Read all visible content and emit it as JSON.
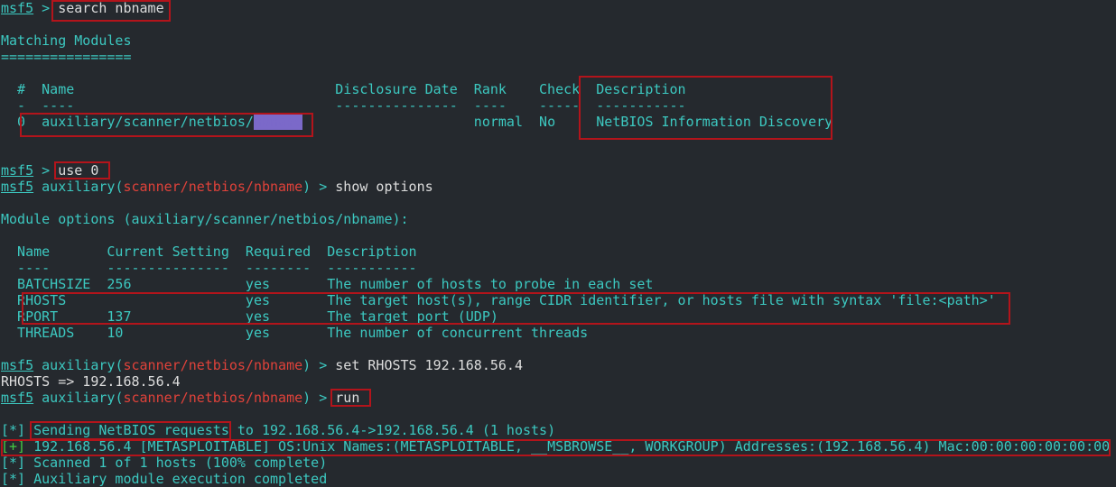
{
  "prompt": {
    "name": "msf5",
    "sep": " > "
  },
  "cmd1": "search nbname",
  "matching_title": "Matching Modules",
  "matching_underline": "================",
  "search_table": {
    "header": "  #  Name                                Disclosure Date  Rank    Check  ",
    "header_desc": "Description",
    "dashes": "  -  ----                                ---------------  ----    -----  ",
    "dashes_desc": "-----------",
    "row_pre": "  0  auxiliary/scanner/netbios/",
    "row_match": "nbname",
    "row_mid": "                     normal  No     ",
    "row_desc": "NetBIOS Information Discovery"
  },
  "cmd2": "use 0",
  "module_kw": "auxiliary",
  "module_path": "scanner/netbios/nbname",
  "cmd3": "show options",
  "module_options_title": "Module options (auxiliary/scanner/netbios/nbname):",
  "options_table": {
    "header": "  Name       Current Setting  Required  Description",
    "dashes": "  ----       ---------------  --------  -----------",
    "rows": [
      "  BATCHSIZE  256              yes       The number of hosts to probe in each set",
      "  RHOSTS                      yes       The target host(s), range CIDR identifier, or hosts file with syntax 'file:<path>'",
      "  RPORT      137              yes       The target port (UDP)",
      "  THREADS    10               yes       The number of concurrent threads"
    ]
  },
  "cmd4": "set RHOSTS 192.168.56.4",
  "rhosts_echo": "RHOSTS => 192.168.56.4",
  "cmd5": "run",
  "output": {
    "l1_marker": "[*]",
    "l1_boxed": "Sending NetBIOS requests",
    "l1_rest": " to 192.168.56.4->192.168.56.4 (1 hosts)",
    "l2_marker": "[+]",
    "l2_text": " 192.168.56.4 [METASPLOITABLE] OS:Unix Names:(METASPLOITABLE, __MSBROWSE__, WORKGROUP) Addresses:(192.168.56.4) Mac:00:00:00:00:00:00",
    "l3_marker": "[*]",
    "l3_text": " Scanned 1 of 1 hosts (100% complete)",
    "l4_marker": "[*]",
    "l4_text": " Auxiliary module execution completed"
  },
  "colors": {
    "background": "#25292e",
    "text": "#3cc8c0",
    "module_path": "#e0423a",
    "highlight_box": "#b3141b",
    "match_highlight": "#7b69c9",
    "success_marker": "#44cc44"
  }
}
